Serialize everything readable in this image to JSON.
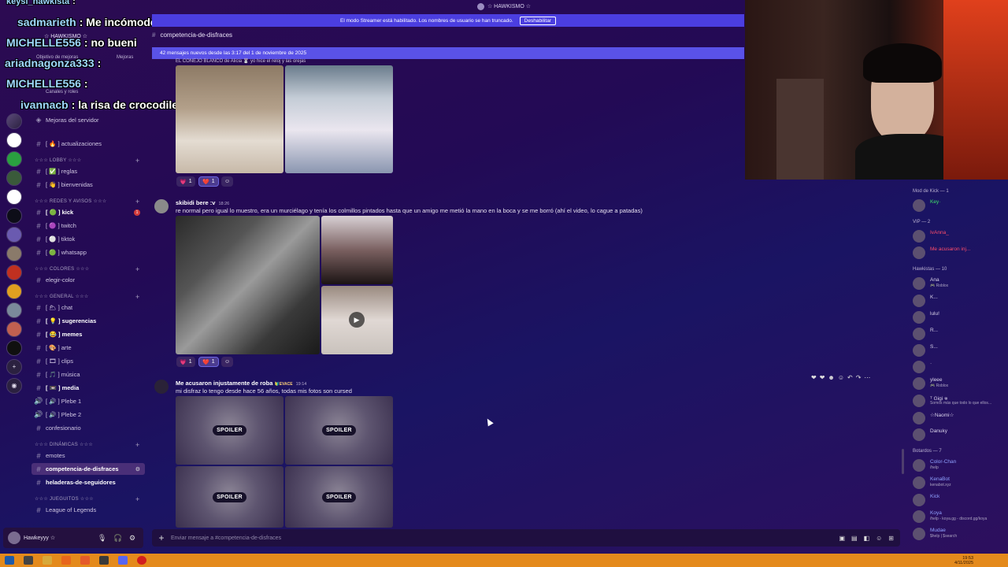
{
  "window": {
    "title": "☆ HAWKISMO ☆"
  },
  "banner": {
    "streamer_text": "El modo Streamer está habilitado. Los nombres de usuario se han truncado.",
    "disable_label": "Deshabilitar",
    "new_messages": "42 mensajes nuevos desde las 3:17 del 1 de noviembre de 2025"
  },
  "server": {
    "name": "☆ HAWKISMO ☆",
    "goal": "Objetivo de mejoras",
    "goal_right": "Mejoras",
    "roles": "Canales y roles",
    "boosts": "Mejoras del servidor"
  },
  "channels": [
    {
      "label": "[ 🔥 ] actualizaciones",
      "bold": false
    },
    {
      "category": "☆☆☆ LOBBY ☆☆☆"
    },
    {
      "label": "[ ✅ ] reglas",
      "bold": false
    },
    {
      "label": "[ 👋 ] bienvenidas",
      "bold": false
    },
    {
      "category": "☆☆☆ REDES Y AVISOS ☆☆☆"
    },
    {
      "label": "[ 🟢 ] kick",
      "bold": true,
      "badge": "1"
    },
    {
      "label": "[ 🟣 ] twitch",
      "bold": false
    },
    {
      "label": "[ ⚪ ] tiktok",
      "bold": false
    },
    {
      "label": "[ 🟢 ] whatsapp",
      "bold": false
    },
    {
      "category": "☆☆☆ COLORES ☆☆☆"
    },
    {
      "label": "elegir-color",
      "bold": false
    },
    {
      "category": "☆☆☆ GENERAL ☆☆☆"
    },
    {
      "label": "[ 🌥 ] chat",
      "bold": false
    },
    {
      "label": "[ 💡 ] sugerencias",
      "bold": true
    },
    {
      "label": "[ 😂 ] memes",
      "bold": true
    },
    {
      "label": "[ 🎨 ] arte",
      "bold": false
    },
    {
      "label": "[ 🎞 ] clips",
      "bold": false
    },
    {
      "label": "[ 🎵 ] música",
      "bold": false
    },
    {
      "label": "[ 📼 ] media",
      "bold": true
    },
    {
      "label": "[ 🔊 ] Plebe 1",
      "bold": false
    },
    {
      "label": "[ 🔊 ] Plebe 2",
      "bold": false
    },
    {
      "label": "confesionario",
      "bold": false
    },
    {
      "category": "☆☆☆ DINÁMICAS ☆☆☆"
    },
    {
      "label": "emotes",
      "bold": false
    },
    {
      "label": "competencia-de-disfraces",
      "bold": true,
      "selected": true
    },
    {
      "label": "heladeras-de-seguidores",
      "bold": true
    },
    {
      "category": "☆☆☆ JUEGUITOS ☆☆☆"
    },
    {
      "label": "League of Legends",
      "bold": false
    }
  ],
  "user": {
    "name": "Hawkeyyy ☆",
    "status": "..."
  },
  "overlay_chat": [
    {
      "name": "keysi_hawkista",
      "text": ":"
    },
    {
      "name": "sadmarieth",
      "text": ": Me incómode"
    },
    {
      "name": "MICHELLE556",
      "text": ": no bueni"
    },
    {
      "name": "ariadnagonza333",
      "text": ":"
    },
    {
      "name": "MICHELLE556",
      "text": ":"
    },
    {
      "name": "ivannacb",
      "text": ": la risa de crocodile"
    }
  ],
  "chat": {
    "channel_name": "competencia-de-disfraces",
    "top_caption": "EL CONEJO BLANCO de Alicia 🐰 yo hice el reloj y las orejas",
    "msg1": {
      "author": "skibidi bere :v",
      "time": "18:26",
      "text": "re normal pero igual lo muestro, era un murciélago y tenía los colmillos pintados hasta que un amigo me metió la mano en la boca y se me borró (ahí el video, lo cague a patadas)"
    },
    "msg2": {
      "author": "Me acusaron injustamente de roba",
      "tag": "🔰EVACE",
      "time": "19:14",
      "text": "mi disfraz lo tengo desde hace 56 años, todas mis fotos son cursed"
    },
    "reactions": {
      "r1": "1",
      "r2": "1"
    },
    "spoiler_label": "SPOILER",
    "placeholder": "Enviar mensaje a #competencia-de-disfraces"
  },
  "members": {
    "groups": [
      {
        "label": "Mod de Kick — 1",
        "members": [
          {
            "name": "Key·",
            "sub": ""
          }
        ]
      },
      {
        "label": "VIP — 2",
        "members": [
          {
            "name": "IvAnna_",
            "sub": ""
          },
          {
            "name": "Me acusaron inj...",
            "sub": ""
          }
        ]
      },
      {
        "label": "Hawkistas — 10",
        "members": [
          {
            "name": "Ana",
            "sub": "🎮 Roblox"
          },
          {
            "name": "K...",
            "sub": ""
          },
          {
            "name": "lulu!",
            "sub": ""
          },
          {
            "name": "R...",
            "sub": ""
          },
          {
            "name": "S...",
            "sub": ""
          },
          {
            "name": "·",
            "sub": ""
          },
          {
            "name": "yleee",
            "sub": "🎮 Roblox"
          },
          {
            "name": "ᵀ Gigi 𖦹",
            "sub": "Somos más que todo lo que ellos..."
          },
          {
            "name": "☆Naomi☆",
            "sub": ""
          },
          {
            "name": "Danuky",
            "sub": ""
          }
        ]
      },
      {
        "label": "Botardos — 7",
        "members": [
          {
            "name": "Color-Chan",
            "sub": "/help"
          },
          {
            "name": "KenaBot",
            "sub": "kenabot.xyz"
          },
          {
            "name": "Kick",
            "sub": ""
          },
          {
            "name": "Koya",
            "sub": "/help - koya.gg - discord.gg/koya"
          },
          {
            "name": "Mudae",
            "sub": "$help | $search"
          }
        ]
      }
    ]
  },
  "taskbar": {
    "time": "19:53",
    "date": "4/11/2025"
  }
}
